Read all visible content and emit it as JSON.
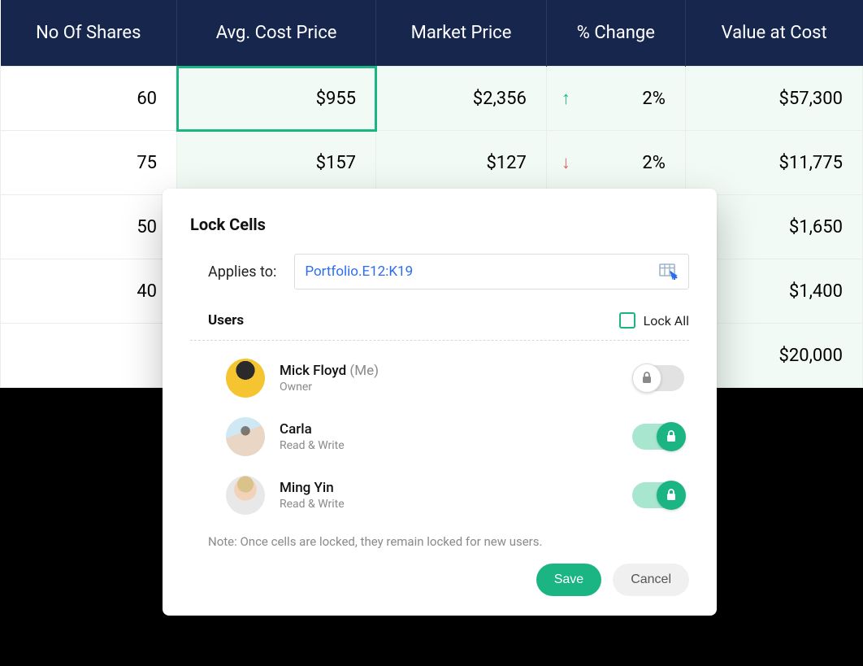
{
  "table": {
    "headers": [
      "No Of Shares",
      "Avg. Cost Price",
      "Market Price",
      "% Change",
      "Value at Cost"
    ],
    "rows": [
      {
        "shares": "60",
        "avg": "$955",
        "market": "$2,356",
        "change_dir": "up",
        "change": "2%",
        "value": "$57,300"
      },
      {
        "shares": "75",
        "avg": "$157",
        "market": "$127",
        "change_dir": "down",
        "change": "2%",
        "value": "$11,775"
      },
      {
        "shares": "50",
        "avg": "",
        "market": "",
        "change_dir": "",
        "change": "",
        "value": "$1,650"
      },
      {
        "shares": "40",
        "avg": "",
        "market": "",
        "change_dir": "",
        "change": "",
        "value": "$1,400"
      },
      {
        "shares": "",
        "avg": "",
        "market": "",
        "change_dir": "",
        "change": "",
        "value": "$20,000"
      }
    ]
  },
  "dialog": {
    "title": "Lock Cells",
    "applies_label": "Applies to:",
    "range": "Portfolio.E12:K19",
    "users_label": "Users",
    "lock_all_label": "Lock All",
    "users": [
      {
        "name": "Mick Floyd",
        "suffix": "(Me)",
        "role": "Owner",
        "locked": false
      },
      {
        "name": "Carla",
        "suffix": "",
        "role": "Read & Write",
        "locked": true
      },
      {
        "name": "Ming Yin",
        "suffix": "",
        "role": "Read & Write",
        "locked": true
      }
    ],
    "note": "Note: Once cells are locked, they remain locked for new users.",
    "save_label": "Save",
    "cancel_label": "Cancel"
  }
}
